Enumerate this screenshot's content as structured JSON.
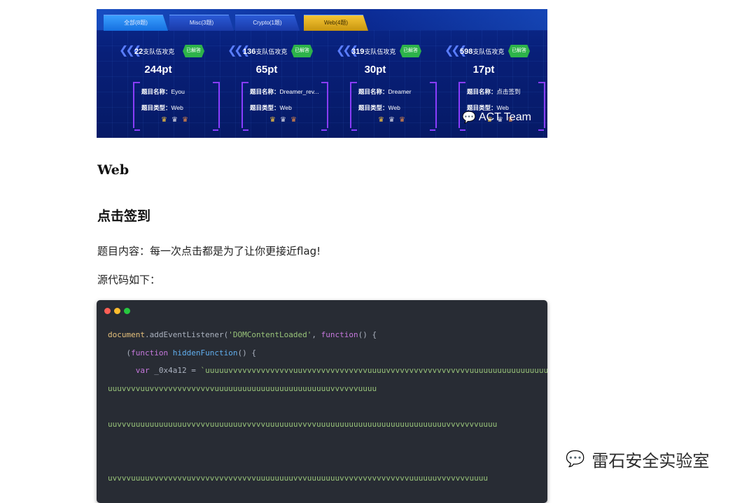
{
  "banner": {
    "tabs": [
      {
        "label": "全部(8题)"
      },
      {
        "label": "Misc(3题)"
      },
      {
        "label": "Crypto(1题)"
      },
      {
        "label": "Web(4题)"
      }
    ],
    "cards": [
      {
        "count": "22",
        "count_suffix": "支队伍攻克",
        "badge": "已解答",
        "points": "244pt",
        "name_label": "题目名称：",
        "name": "Eyou",
        "type_label": "题目类型：",
        "type": "Web"
      },
      {
        "count": "136",
        "count_suffix": "支队伍攻克",
        "badge": "已解答",
        "points": "65pt",
        "name_label": "题目名称：",
        "name": "Dreamer_rev...",
        "type_label": "题目类型：",
        "type": "Web"
      },
      {
        "count": "319",
        "count_suffix": "支队伍攻克",
        "badge": "已解答",
        "points": "30pt",
        "name_label": "题目名称：",
        "name": "Dreamer",
        "type_label": "题目类型：",
        "type": "Web"
      },
      {
        "count": "598",
        "count_suffix": "支队伍攻克",
        "badge": "已解答",
        "points": "17pt",
        "name_label": "题目名称：",
        "name": "点击签到",
        "type_label": "题目类型：",
        "type": "Web"
      }
    ],
    "watermark": "ACT Team"
  },
  "article": {
    "heading": "Web",
    "subheading": "点击签到",
    "description": "题目内容：每一次点击都是为了让你更接近flag!",
    "source_intro": "源代码如下："
  },
  "code": {
    "l1_obj": "document",
    "l1_dot": ".",
    "l1_fn": "addEventListener",
    "l1_open": "(",
    "l1_str": "'DOMContentLoaded'",
    "l1_comma": ", ",
    "l1_kw": "function",
    "l1_end": "() {",
    "l2_indent": "    (",
    "l2_kw": "function",
    "l2_sp": " ",
    "l2_fn": "hiddenFunction",
    "l2_end": "() {",
    "l3_indent": "      ",
    "l3_kw": "var",
    "l3_var": " _0x4a12 = ",
    "l3_str": "`uuuuuvvvvvvvvvvvvvvuuvvvvvvvvvvvvvvuuuuvvvvvvvvvvvvvvvvvvuuuuuuuuuuuuuuuuuuuuuuuuuu",
    "l4_str": "uuuvvvvuuvvvvvvvvvvvvvvuuuuuuuuuuuuuuuuuuuuuuuuuvvvvvvuuuu",
    "l5_str": "uuvvvuuuuuuuuuuuuvvvvvuuuuuuuvvvvvuuuuuuuvvvvuuuuuuuuuuuuuuuuuuuuuuuuuuuuvvvvvvvuuuu",
    "l6_str": "uvvvvuuuuvvvvvvvvuvvvvvvvvvvvvvvuuuuuuuuvvvuuuuuuuvvvvvvvvvvvvvvvuuuuuuvvvvvvvuuuu"
  },
  "watermark": {
    "text": "雷石安全实验室"
  },
  "colors": {
    "banner_bg": "#081f78",
    "code_bg": "#282c34",
    "badge_green": "#2db34a",
    "frame_purple": "#8a3dff"
  }
}
